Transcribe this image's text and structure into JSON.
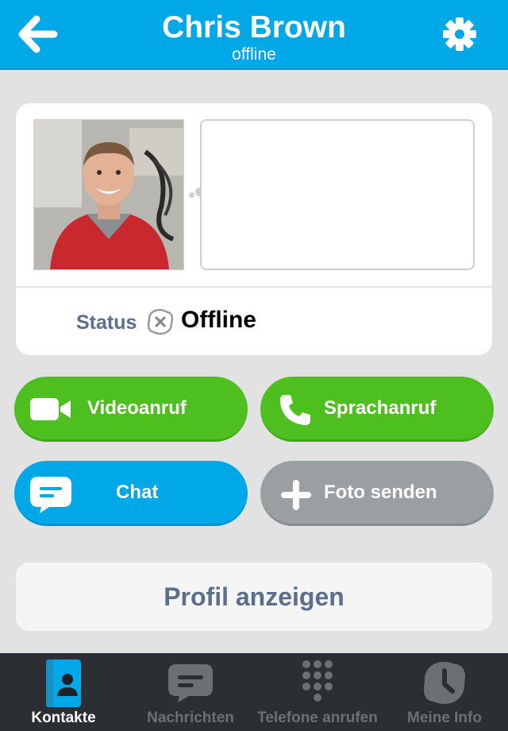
{
  "header": {
    "title": "Chris Brown",
    "subtitle": "offline",
    "back_icon": "arrow-left-icon",
    "settings_icon": "gear-icon"
  },
  "profile": {
    "mood_message": "",
    "status_label": "Status",
    "status_value": "Offline",
    "status_icon": "offline-x-icon"
  },
  "actions": {
    "video_call": "Videoanruf",
    "voice_call": "Sprachanruf",
    "chat": "Chat",
    "send_photo": "Foto senden"
  },
  "profile_button": "Profil anzeigen",
  "tabs": [
    {
      "label": "Kontakte",
      "icon": "contacts-icon",
      "active": true
    },
    {
      "label": "Nachrichten",
      "icon": "chat-bubble-icon",
      "active": false
    },
    {
      "label": "Telefone anrufen",
      "icon": "dialpad-icon",
      "active": false
    },
    {
      "label": "Meine Info",
      "icon": "skype-clock-icon",
      "active": false
    }
  ],
  "colors": {
    "header_blue": "#00a8e8",
    "call_green": "#4dbf1f",
    "chat_blue": "#00a8e8",
    "photo_gray": "#9aa0a2",
    "tabbar": "#2b2e33",
    "label_slate": "#5b6e8c"
  }
}
